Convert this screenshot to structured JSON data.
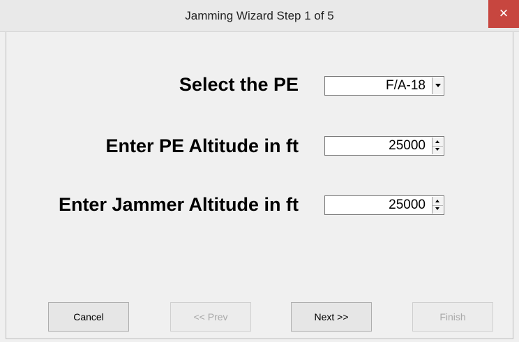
{
  "window": {
    "title": "Jamming Wizard Step 1 of 5",
    "close_glyph": "×"
  },
  "form": {
    "pe": {
      "label": "Select the PE",
      "value": "F/A-18"
    },
    "pe_altitude": {
      "label": "Enter PE Altitude in ft",
      "value": "25000"
    },
    "jammer_altitude": {
      "label": "Enter Jammer Altitude in ft",
      "value": "25000"
    }
  },
  "buttons": {
    "cancel": "Cancel",
    "prev": "<< Prev",
    "next": "Next >>",
    "finish": "Finish"
  }
}
